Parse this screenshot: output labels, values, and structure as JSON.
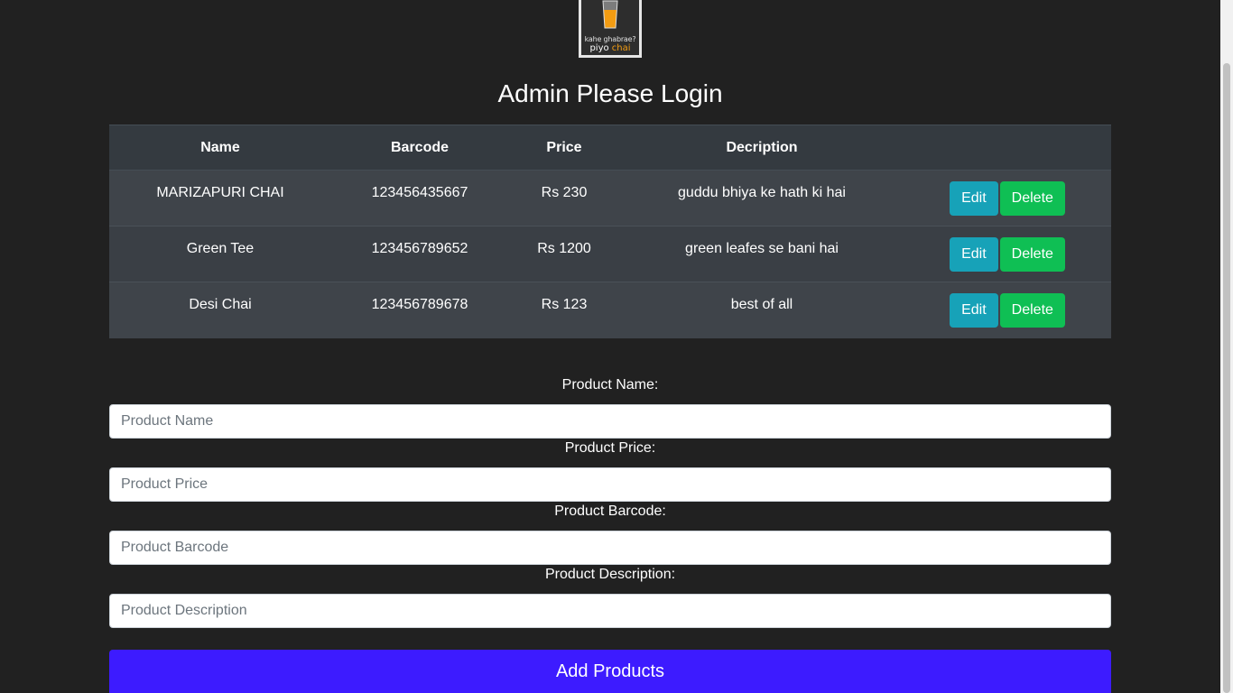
{
  "logo": {
    "line1": "kahe ghabrae?",
    "line2_a": "piyo",
    "line2_b": "chai",
    "accent_color": "#f39c12"
  },
  "header": {
    "title": "Admin Please Login"
  },
  "table": {
    "columns": [
      "Name",
      "Barcode",
      "Price",
      "Decription",
      ""
    ],
    "rows": [
      {
        "name": "MARIZAPURI CHAI",
        "barcode": "123456435667",
        "price": "Rs 230",
        "description": "guddu bhiya ke hath ki hai",
        "edit_label": "Edit",
        "delete_label": "Delete"
      },
      {
        "name": "Green Tee",
        "barcode": "123456789652",
        "price": "Rs 1200",
        "description": "green leafes se bani hai",
        "edit_label": "Edit",
        "delete_label": "Delete"
      },
      {
        "name": "Desi Chai",
        "barcode": "123456789678",
        "price": "Rs 123",
        "description": "best of all",
        "edit_label": "Edit",
        "delete_label": "Delete"
      }
    ]
  },
  "form": {
    "name": {
      "label": "Product Name:",
      "placeholder": "Product Name",
      "value": ""
    },
    "price": {
      "label": "Product Price:",
      "placeholder": "Product Price",
      "value": ""
    },
    "barcode": {
      "label": "Product Barcode:",
      "placeholder": "Product Barcode",
      "value": ""
    },
    "description": {
      "label": "Product Description:",
      "placeholder": "Product Description",
      "value": ""
    },
    "submit_label": "Add Products"
  },
  "colors": {
    "background": "#212121",
    "edit_button": "#17a2b8",
    "delete_button": "#0fbf54",
    "add_button": "#3d1bff"
  }
}
